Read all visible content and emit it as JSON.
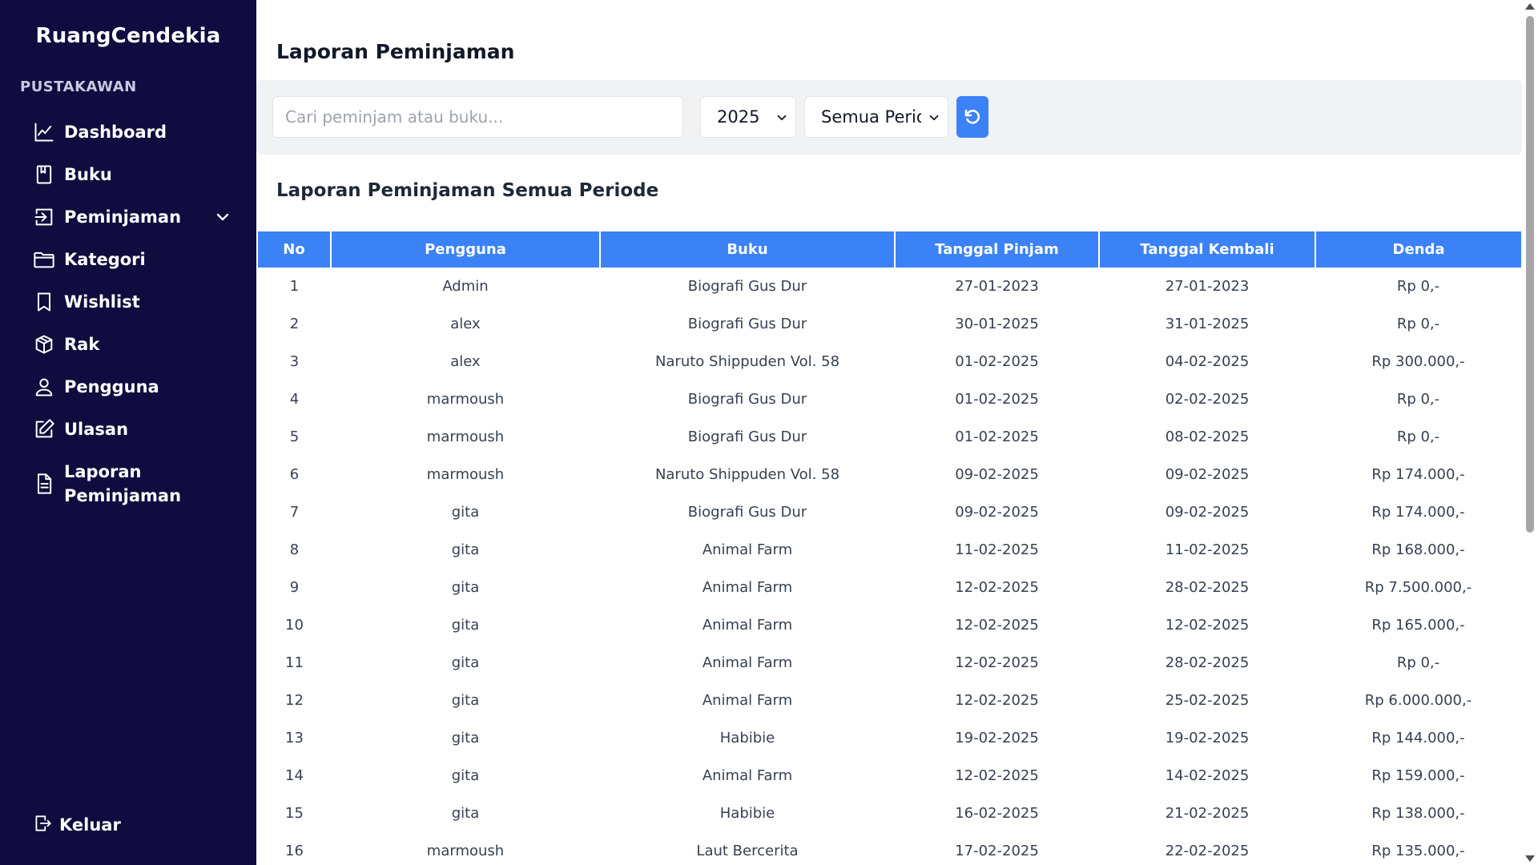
{
  "sidebar": {
    "brand": "RuangCendekia",
    "section_label": "PUSTAKAWAN",
    "items": [
      {
        "label": "Dashboard",
        "icon": "chart-line-icon"
      },
      {
        "label": "Buku",
        "icon": "book-icon"
      },
      {
        "label": "Peminjaman",
        "icon": "login-arrow-icon"
      },
      {
        "label": "Kategori",
        "icon": "folder-icon"
      },
      {
        "label": "Wishlist",
        "icon": "bookmark-icon"
      },
      {
        "label": "Rak",
        "icon": "box-shelf-icon"
      },
      {
        "label": "Pengguna",
        "icon": "user-icon"
      },
      {
        "label": "Ulasan",
        "icon": "pencil-square-icon"
      },
      {
        "label": "Laporan Peminjaman",
        "icon": "document-icon"
      }
    ],
    "logout_label": "Keluar"
  },
  "main": {
    "page_title": "Laporan Peminjaman",
    "search_placeholder": "Cari peminjam atau buku...",
    "year_value": "2025",
    "period_value": "Semua Periode",
    "subtitle": "Laporan Peminjaman Semua Periode",
    "table": {
      "headers": [
        "No",
        "Pengguna",
        "Buku",
        "Tanggal Pinjam",
        "Tanggal Kembali",
        "Denda"
      ],
      "rows": [
        [
          "1",
          "Admin",
          "Biografi Gus Dur",
          "27-01-2023",
          "27-01-2023",
          "Rp 0,-"
        ],
        [
          "2",
          "alex",
          "Biografi Gus Dur",
          "30-01-2025",
          "31-01-2025",
          "Rp 0,-"
        ],
        [
          "3",
          "alex",
          "Naruto Shippuden Vol. 58",
          "01-02-2025",
          "04-02-2025",
          "Rp 300.000,-"
        ],
        [
          "4",
          "marmoush",
          "Biografi Gus Dur",
          "01-02-2025",
          "02-02-2025",
          "Rp 0,-"
        ],
        [
          "5",
          "marmoush",
          "Biografi Gus Dur",
          "01-02-2025",
          "08-02-2025",
          "Rp 0,-"
        ],
        [
          "6",
          "marmoush",
          "Naruto Shippuden Vol. 58",
          "09-02-2025",
          "09-02-2025",
          "Rp 174.000,-"
        ],
        [
          "7",
          "gita",
          "Biografi Gus Dur",
          "09-02-2025",
          "09-02-2025",
          "Rp 174.000,-"
        ],
        [
          "8",
          "gita",
          "Animal Farm",
          "11-02-2025",
          "11-02-2025",
          "Rp 168.000,-"
        ],
        [
          "9",
          "gita",
          "Animal Farm",
          "12-02-2025",
          "28-02-2025",
          "Rp 7.500.000,-"
        ],
        [
          "10",
          "gita",
          "Animal Farm",
          "12-02-2025",
          "12-02-2025",
          "Rp 165.000,-"
        ],
        [
          "11",
          "gita",
          "Animal Farm",
          "12-02-2025",
          "28-02-2025",
          "Rp 0,-"
        ],
        [
          "12",
          "gita",
          "Animal Farm",
          "12-02-2025",
          "25-02-2025",
          "Rp 6.000.000,-"
        ],
        [
          "13",
          "gita",
          "Habibie",
          "19-02-2025",
          "19-02-2025",
          "Rp 144.000,-"
        ],
        [
          "14",
          "gita",
          "Animal Farm",
          "12-02-2025",
          "14-02-2025",
          "Rp 159.000,-"
        ],
        [
          "15",
          "gita",
          "Habibie",
          "16-02-2025",
          "21-02-2025",
          "Rp 138.000,-"
        ],
        [
          "16",
          "marmoush",
          "Laut Bercerita",
          "17-02-2025",
          "22-02-2025",
          "Rp 135.000,-"
        ]
      ]
    }
  },
  "colors": {
    "sidebar_bg": "#100c3f",
    "accent": "#3b82f6",
    "filter_bg": "#f1f2f4"
  }
}
